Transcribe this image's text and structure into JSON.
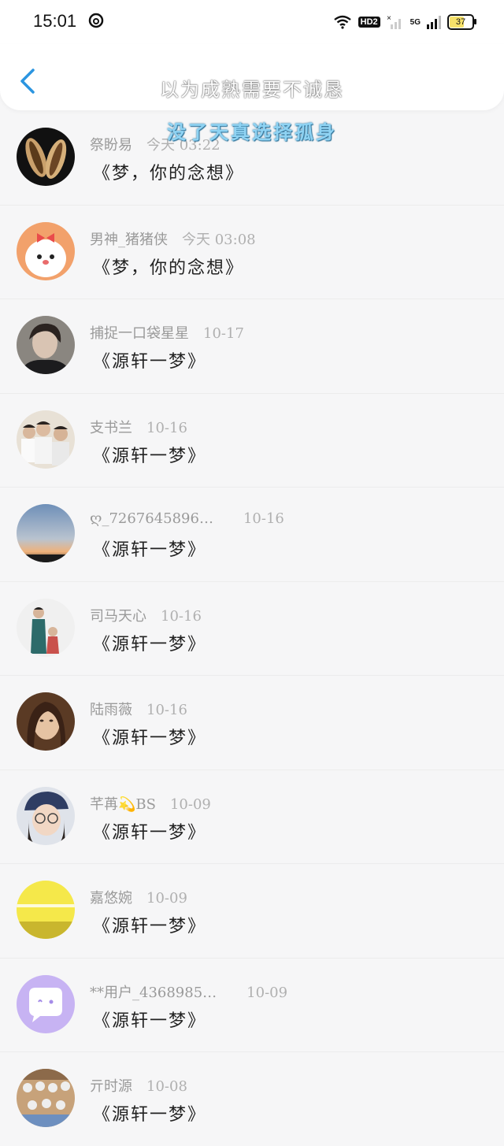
{
  "status_bar": {
    "time": "15:01",
    "hd_badge": "HD2",
    "network": "5G",
    "battery": "37"
  },
  "nav": {
    "title": "以为成熟需要不诚恳",
    "caption": "没了天真选择孤身"
  },
  "messages": [
    {
      "name": "祭盼易",
      "date": "今天 03:22",
      "text": "《梦，你的念想》",
      "avatar": "shell-avatar"
    },
    {
      "name": "男神_猪猪侠",
      "date": "今天 03:08",
      "text": "《梦，你的念想》",
      "avatar": "cartoon-avatar"
    },
    {
      "name": "捕捉一口袋星星",
      "date": "10-17",
      "text": "《源轩一梦》",
      "avatar": "girl-avatar"
    },
    {
      "name": "支书兰",
      "date": "10-16",
      "text": "《源轩一梦》",
      "avatar": "group-avatar"
    },
    {
      "name": "ღ_7267645896…",
      "date": "10-16",
      "text": "《源轩一梦》",
      "avatar": "sunset-avatar"
    },
    {
      "name": "司马天心",
      "date": "10-16",
      "text": "《源轩一梦》",
      "avatar": "people-avatar"
    },
    {
      "name": "陆雨薇",
      "date": "10-16",
      "text": "《源轩一梦》",
      "avatar": "portrait-avatar"
    },
    {
      "name": "芊苒💫BS",
      "date": "10-09",
      "text": "《源轩一梦》",
      "avatar": "cap-girl-avatar"
    },
    {
      "name": "嘉悠婉",
      "date": "10-09",
      "text": "《源轩一梦》",
      "avatar": "yellow-avatar"
    },
    {
      "name": "**用户_4368985…",
      "date": "10-09",
      "text": "《源轩一梦》",
      "avatar": "chat-bubble-avatar"
    },
    {
      "name": "亓时源",
      "date": "10-08",
      "text": "《源轩一梦》",
      "avatar": "class-avatar"
    }
  ],
  "colors": {
    "accent": "#2b95e0",
    "background": "#f6f6f7",
    "caption": "#8fd3f3"
  }
}
